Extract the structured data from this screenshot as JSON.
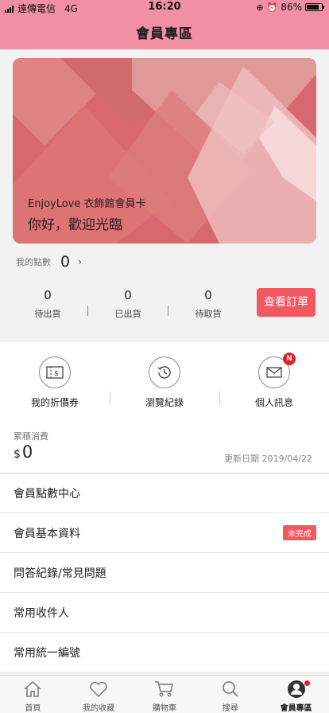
{
  "status": {
    "carrier": "遠傳電信",
    "network": "4G",
    "time": "16:20",
    "battery": "86%",
    "battery_level": 0.86
  },
  "header": {
    "title": "會員專區"
  },
  "card": {
    "subtitle": "EnjoyLove 衣飾館會員卡",
    "greeting": "你好，歡迎光臨"
  },
  "points": {
    "label": "我的點數",
    "value": "0",
    "arrow": "›"
  },
  "orders": {
    "stats": [
      {
        "count": "0",
        "label": "待出貨"
      },
      {
        "count": "0",
        "label": "已出貨"
      },
      {
        "count": "0",
        "label": "待取貨"
      }
    ],
    "button_label": "查看訂單"
  },
  "shortcuts": [
    {
      "label": "我的折價券",
      "icon": "coupon-icon"
    },
    {
      "label": "瀏覽紀錄",
      "icon": "history-icon"
    },
    {
      "label": "個人訊息",
      "icon": "mail-icon",
      "badge": "N"
    }
  ],
  "spending": {
    "label": "累積消費",
    "currency": "$",
    "value": "0",
    "updated": "更新日期 2019/04/22"
  },
  "menu": [
    {
      "label": "會員點數中心"
    },
    {
      "label": "會員基本資料",
      "tag": "未完成"
    },
    {
      "label": "問答紀錄/常見問題"
    },
    {
      "label": "常用收件人"
    },
    {
      "label": "常用統一編號"
    }
  ],
  "tabs": [
    {
      "label": "首頁",
      "icon": "home-icon"
    },
    {
      "label": "我的收藏",
      "icon": "heart-icon"
    },
    {
      "label": "購物車",
      "icon": "cart-icon"
    },
    {
      "label": "搜尋",
      "icon": "search-icon"
    },
    {
      "label": "會員專區",
      "icon": "user-icon",
      "active": true
    }
  ],
  "colors": {
    "header": "#f190a4",
    "accent": "#f2595e",
    "card": "#d9686f",
    "badge": "#e8202a"
  }
}
